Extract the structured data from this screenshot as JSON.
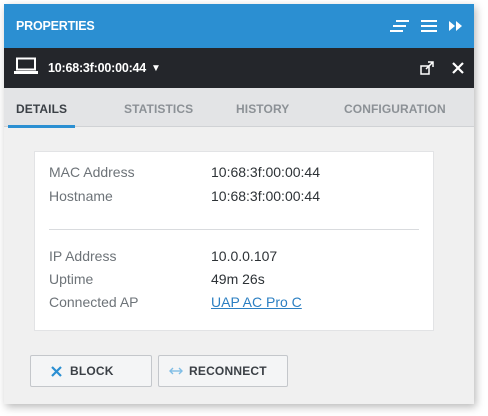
{
  "panel": {
    "title": "PROPERTIES",
    "header_icons": [
      "collapse-sections-icon",
      "menu-icon",
      "fast-forward-icon"
    ]
  },
  "device": {
    "icon": "laptop-icon",
    "name": "10:68:3f:00:00:44",
    "caret": "▼",
    "actions": [
      "popout-icon",
      "close-icon"
    ]
  },
  "tabs": [
    {
      "label": "DETAILS",
      "active": true
    },
    {
      "label": "STATISTICS",
      "active": false
    },
    {
      "label": "HISTORY",
      "active": false
    },
    {
      "label": "CONFIGURATION",
      "active": false
    }
  ],
  "details": {
    "mac_label": "MAC Address",
    "mac_value": "10:68:3f:00:00:44",
    "hostname_label": "Hostname",
    "hostname_value": "10:68:3f:00:00:44",
    "ip_label": "IP Address",
    "ip_value": "10.0.0.107",
    "uptime_label": "Uptime",
    "uptime_value": "49m 26s",
    "ap_label": "Connected AP",
    "ap_value": "UAP AC Pro C"
  },
  "actions": {
    "block_label": "BLOCK",
    "block_icon": "x-icon",
    "reconnect_label": "RECONNECT",
    "reconnect_icon": "reconnect-arrows-icon"
  },
  "colors": {
    "header_blue": "#2b8fd2",
    "device_bar": "#24262b",
    "tab_bar": "#e3e4e6",
    "link": "#2b7fc2",
    "block_icon": "#2b8fd2",
    "reconnect_icon": "#7fbde6"
  }
}
